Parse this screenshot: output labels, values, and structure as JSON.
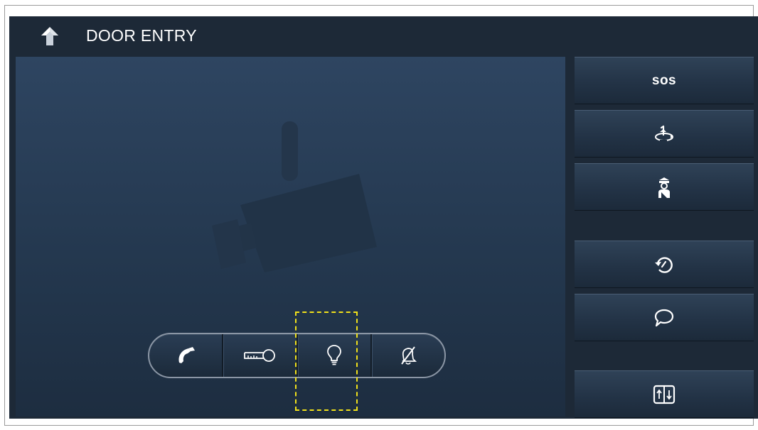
{
  "header": {
    "title": "DOOR ENTRY",
    "back_icon": "back-arrow-icon"
  },
  "video": {
    "placeholder_icon": "security-camera-icon"
  },
  "call_controls": [
    {
      "name": "answer",
      "icon": "phone-handset-icon"
    },
    {
      "name": "unlock",
      "icon": "key-icon"
    },
    {
      "name": "light",
      "icon": "light-bulb-icon",
      "highlighted": true
    },
    {
      "name": "mute",
      "icon": "muted-bell-icon"
    }
  ],
  "side_buttons": [
    {
      "name": "sos",
      "label": "sos"
    },
    {
      "name": "surveillance",
      "icon": "rotate-camera-icon"
    },
    {
      "name": "guard",
      "icon": "guard-icon"
    },
    {
      "name": "history",
      "icon": "history-icon"
    },
    {
      "name": "message",
      "icon": "speech-bubble-icon"
    },
    {
      "name": "elevator",
      "icon": "elevator-icon"
    }
  ],
  "colors": {
    "background": "#1d2937",
    "video_top": "#2e4561",
    "highlight": "#f2e21a",
    "text": "#ffffff"
  }
}
